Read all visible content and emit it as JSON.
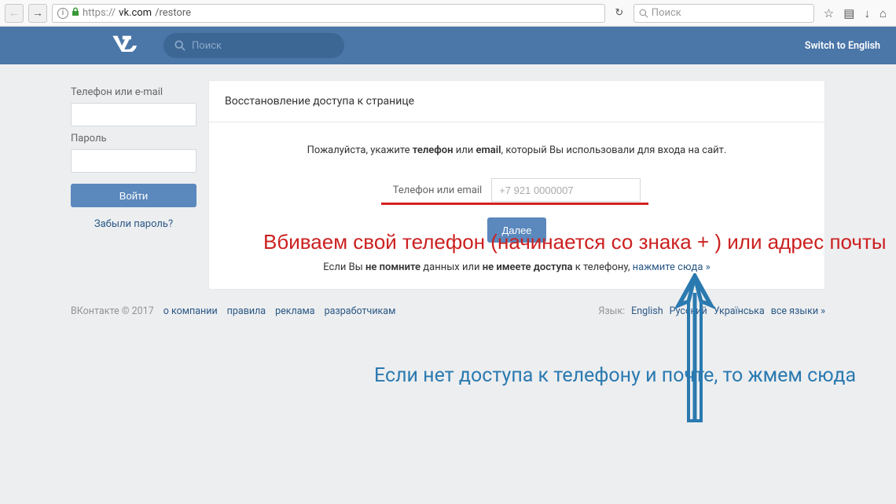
{
  "browser": {
    "url_protocol": "https://",
    "url_host": "vk.com",
    "url_path": "/restore",
    "search_placeholder": "Поиск"
  },
  "vk_header": {
    "logo_text": "w",
    "search_placeholder": "Поиск",
    "switch_english": "Switch to English"
  },
  "sidebar": {
    "login_label": "Телефон или e-mail",
    "password_label": "Пароль",
    "login_btn": "Войти",
    "forgot_link": "Забыли пароль?"
  },
  "content": {
    "header_title": "Восстановление доступа к странице",
    "prompt_pre": "Пожалуйста, укажите ",
    "prompt_phone": "телефон",
    "prompt_or": " или ",
    "prompt_email": "email",
    "prompt_post": ", который Вы использовали для входа на сайт.",
    "input_label": "Телефон или email",
    "input_placeholder": "+7 921 0000007",
    "next_btn": "Далее",
    "help_pre": "Если Вы ",
    "help_b1": "не помните",
    "help_mid1": " данных или ",
    "help_b2": "не имеете доступа",
    "help_mid2": " к телефону, ",
    "help_link": "нажмите сюда »"
  },
  "footer": {
    "copyright": "ВКонтакте © 2017",
    "links": [
      "о компании",
      "правила",
      "реклама",
      "разработчикам"
    ],
    "lang_label": "Язык:",
    "langs": [
      "English",
      "Русский",
      "Українська",
      "все языки »"
    ]
  },
  "annotations": {
    "red": "Вбиваем свой телефон (начинается со знака + ) или адрес почты",
    "blue": "Если нет доступа к телефону и почте, то жмем сюда"
  }
}
